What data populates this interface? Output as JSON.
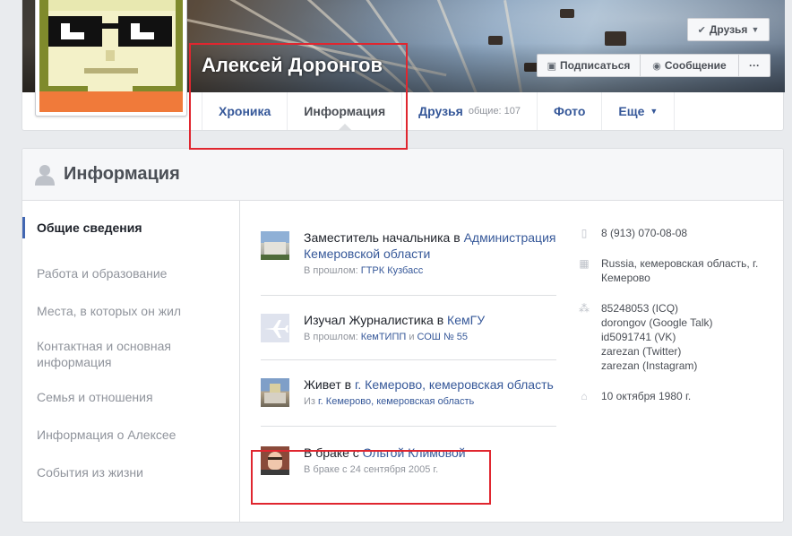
{
  "profile": {
    "name": "Алексей Доронгов",
    "buttons": {
      "friends": "Друзья",
      "subscribe": "Подписаться",
      "message": "Сообщение",
      "more": "···"
    },
    "tabs": [
      {
        "label": "Хроника"
      },
      {
        "label": "Информация"
      },
      {
        "label": "Друзья",
        "count": "общие: 107"
      },
      {
        "label": "Фото"
      },
      {
        "label": "Еще"
      }
    ]
  },
  "info": {
    "title": "Информация",
    "sidebar": [
      "Общие сведения",
      "Работа и образование",
      "Места, в которых он жил",
      "Контактная и основная информация",
      "Семья и отношения",
      "Информация о Алексее",
      "События из жизни"
    ],
    "entries": {
      "work": {
        "main": "Заместитель начальника в ",
        "link": "Администрация Кемеровской области",
        "sub_prefix": "В прошлом: ",
        "sub_link": "ГТРК Кузбасс"
      },
      "education": {
        "main": "Изучал Журналистика в ",
        "link": "КемГУ",
        "sub_prefix": "В прошлом: ",
        "sub_link1": "КемТИПП",
        "sub_sep": " и ",
        "sub_link2": "СОШ № 55"
      },
      "lives": {
        "main": "Живет в ",
        "link": "г. Кемерово, кемеровская область",
        "sub_prefix": "Из ",
        "sub_link": "г. Кемерово, кемеровская область"
      },
      "marriage": {
        "main": "В браке с ",
        "link": "Ольгой Климовой",
        "sub": "В браке с 24 сентября 2005 г."
      }
    },
    "contacts": {
      "phone": "8 (913) 070-08-08",
      "address": "Russia, кемеровская область, г. Кемерово",
      "accounts": [
        "85248053 (ICQ)",
        "dorongov (Google Talk)",
        "id5091741 (VK)",
        "zarezan (Twitter)",
        "zarezan (Instagram)"
      ],
      "birthday": "10 октября 1980 г."
    }
  },
  "colors": {
    "link": "#365899",
    "highlight": "#e0262f",
    "active_bar": "#4267b2"
  }
}
